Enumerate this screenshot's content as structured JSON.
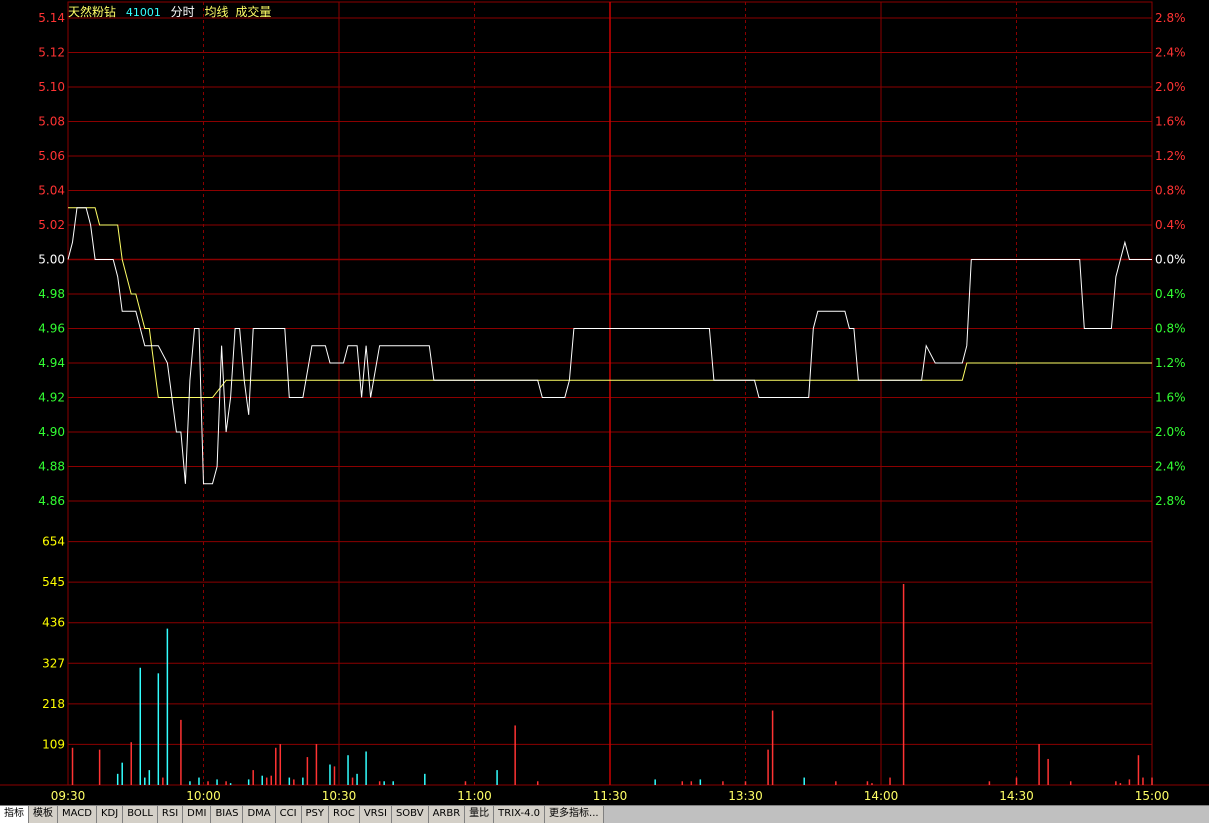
{
  "header": {
    "stock_name": "天然粉钻",
    "stock_code": "41001",
    "mode": "分时",
    "avg_label": "均线",
    "vol_label": "成交量"
  },
  "colors": {
    "background": "#000000",
    "grid": "#8b0000",
    "price_line": "#ffffff",
    "avg_line": "#ffff66",
    "up": "#ff3333",
    "down": "#33ffff",
    "price_up_label": "#ff3333",
    "price_down_label": "#33ff33",
    "volume_label": "#ffff00",
    "time_label": "#ffff66"
  },
  "tabs": [
    "指标",
    "模板",
    "MACD",
    "KDJ",
    "BOLL",
    "RSI",
    "DMI",
    "BIAS",
    "DMA",
    "CCI",
    "PSY",
    "ROC",
    "VRSI",
    "SOBV",
    "ARBR",
    "量比",
    "TRIX-4.0",
    "更多指标..."
  ],
  "chart_data": {
    "type": "line",
    "price_axis": {
      "ticks": [
        "5.14",
        "5.12",
        "5.10",
        "5.08",
        "5.06",
        "5.04",
        "5.02",
        "5.00",
        "4.98",
        "4.96",
        "4.94",
        "4.92",
        "4.90",
        "4.88",
        "4.86"
      ],
      "pct_ticks": [
        "2.8%",
        "2.4%",
        "2.0%",
        "1.6%",
        "1.2%",
        "0.8%",
        "0.4%",
        "0.0%",
        "0.4%",
        "0.8%",
        "1.2%",
        "1.6%",
        "2.0%",
        "2.4%",
        "2.8%"
      ],
      "ylim": [
        4.86,
        5.14
      ],
      "prev_close": 5.0
    },
    "volume_axis": {
      "ticks": [
        "654",
        "545",
        "436",
        "327",
        "218",
        "109"
      ],
      "ylim": [
        0,
        763
      ]
    },
    "time_axis": {
      "labels": [
        "09:30",
        "10:00",
        "10:30",
        "11:00",
        "11:30",
        "13:30",
        "14:00",
        "14:30",
        "15:00"
      ],
      "minutes": 240
    },
    "price_series": [
      [
        0,
        5.0
      ],
      [
        1,
        5.01
      ],
      [
        2,
        5.03
      ],
      [
        4,
        5.03
      ],
      [
        5,
        5.02
      ],
      [
        6,
        5.0
      ],
      [
        8,
        5.0
      ],
      [
        9,
        5.0
      ],
      [
        10,
        5.0
      ],
      [
        11,
        4.99
      ],
      [
        12,
        4.97
      ],
      [
        15,
        4.97
      ],
      [
        17,
        4.95
      ],
      [
        20,
        4.95
      ],
      [
        22,
        4.94
      ],
      [
        24,
        4.9
      ],
      [
        25,
        4.9
      ],
      [
        26,
        4.87
      ],
      [
        27,
        4.93
      ],
      [
        28,
        4.96
      ],
      [
        29,
        4.96
      ],
      [
        30,
        4.87
      ],
      [
        31,
        4.87
      ],
      [
        32,
        4.87
      ],
      [
        33,
        4.88
      ],
      [
        34,
        4.95
      ],
      [
        35,
        4.9
      ],
      [
        36,
        4.92
      ],
      [
        37,
        4.96
      ],
      [
        38,
        4.96
      ],
      [
        39,
        4.93
      ],
      [
        40,
        4.91
      ],
      [
        41,
        4.96
      ],
      [
        42,
        4.96
      ],
      [
        44,
        4.96
      ],
      [
        45,
        4.96
      ],
      [
        47,
        4.96
      ],
      [
        48,
        4.96
      ],
      [
        49,
        4.92
      ],
      [
        51,
        4.92
      ],
      [
        52,
        4.92
      ],
      [
        54,
        4.95
      ],
      [
        57,
        4.95
      ],
      [
        58,
        4.94
      ],
      [
        61,
        4.94
      ],
      [
        62,
        4.95
      ],
      [
        64,
        4.95
      ],
      [
        65,
        4.92
      ],
      [
        66,
        4.95
      ],
      [
        67,
        4.92
      ],
      [
        69,
        4.95
      ],
      [
        71,
        4.95
      ],
      [
        78,
        4.95
      ],
      [
        79,
        4.95
      ],
      [
        80,
        4.95
      ],
      [
        81,
        4.93
      ],
      [
        101,
        4.93
      ],
      [
        104,
        4.93
      ],
      [
        105,
        4.92
      ],
      [
        110,
        4.92
      ],
      [
        111,
        4.93
      ],
      [
        112,
        4.96
      ],
      [
        116,
        4.96
      ],
      [
        117,
        4.96
      ],
      [
        120,
        4.96
      ],
      [
        133,
        4.96
      ],
      [
        134,
        4.96
      ],
      [
        141,
        4.96
      ],
      [
        142,
        4.96
      ],
      [
        143,
        4.93
      ],
      [
        151,
        4.93
      ],
      [
        152,
        4.93
      ],
      [
        153,
        4.92
      ],
      [
        163,
        4.92
      ],
      [
        164,
        4.92
      ],
      [
        165,
        4.96
      ],
      [
        166,
        4.97
      ],
      [
        172,
        4.97
      ],
      [
        173,
        4.96
      ],
      [
        174,
        4.96
      ],
      [
        175,
        4.93
      ],
      [
        187,
        4.93
      ],
      [
        189,
        4.93
      ],
      [
        190,
        4.95
      ],
      [
        192,
        4.94
      ],
      [
        197,
        4.94
      ],
      [
        198,
        4.94
      ],
      [
        199,
        4.95
      ],
      [
        200,
        5.0
      ],
      [
        204,
        5.0
      ],
      [
        215,
        5.0
      ],
      [
        223,
        5.0
      ],
      [
        224,
        5.0
      ],
      [
        225,
        4.96
      ],
      [
        228,
        4.96
      ],
      [
        230,
        4.96
      ],
      [
        231,
        4.96
      ],
      [
        232,
        4.99
      ],
      [
        233,
        5.0
      ],
      [
        234,
        5.01
      ],
      [
        235,
        5.0
      ],
      [
        236,
        5.0
      ],
      [
        237,
        5.0
      ],
      [
        240,
        5.0
      ]
    ],
    "avg_series": [
      [
        0,
        5.03
      ],
      [
        3,
        5.03
      ],
      [
        6,
        5.03
      ],
      [
        7,
        5.02
      ],
      [
        10,
        5.02
      ],
      [
        11,
        5.02
      ],
      [
        12,
        5.0
      ],
      [
        13,
        4.99
      ],
      [
        14,
        4.98
      ],
      [
        15,
        4.98
      ],
      [
        17,
        4.96
      ],
      [
        18,
        4.96
      ],
      [
        19,
        4.94
      ],
      [
        20,
        4.92
      ],
      [
        22,
        4.92
      ],
      [
        23,
        4.92
      ],
      [
        25,
        4.92
      ],
      [
        32,
        4.92
      ],
      [
        35,
        4.93
      ],
      [
        37,
        4.93
      ],
      [
        38,
        4.93
      ],
      [
        40,
        4.93
      ],
      [
        45,
        4.93
      ],
      [
        49,
        4.93
      ],
      [
        53,
        4.93
      ],
      [
        54,
        4.93
      ],
      [
        57,
        4.93
      ],
      [
        62,
        4.93
      ],
      [
        63,
        4.93
      ],
      [
        65,
        4.93
      ],
      [
        68,
        4.93
      ],
      [
        71,
        4.93
      ],
      [
        72,
        4.93
      ],
      [
        74,
        4.93
      ],
      [
        77,
        4.93
      ],
      [
        82,
        4.93
      ],
      [
        85,
        4.93
      ],
      [
        90,
        4.93
      ],
      [
        95,
        4.93
      ],
      [
        97,
        4.93
      ],
      [
        100,
        4.93
      ],
      [
        104,
        4.93
      ],
      [
        108,
        4.93
      ],
      [
        112,
        4.93
      ],
      [
        114,
        4.93
      ],
      [
        122,
        4.93
      ],
      [
        130,
        4.93
      ],
      [
        140,
        4.93
      ],
      [
        150,
        4.93
      ],
      [
        160,
        4.93
      ],
      [
        170,
        4.93
      ],
      [
        180,
        4.93
      ],
      [
        190,
        4.93
      ],
      [
        198,
        4.93
      ],
      [
        199,
        4.94
      ],
      [
        210,
        4.94
      ],
      [
        220,
        4.94
      ],
      [
        226,
        4.94
      ],
      [
        227,
        4.94
      ],
      [
        228,
        4.94
      ],
      [
        235,
        4.94
      ],
      [
        240,
        4.94
      ]
    ],
    "volume_series": [
      [
        1,
        100,
        "up"
      ],
      [
        7,
        95,
        "up"
      ],
      [
        11,
        30,
        "down"
      ],
      [
        12,
        60,
        "down"
      ],
      [
        14,
        115,
        "up"
      ],
      [
        16,
        315,
        "down"
      ],
      [
        17,
        20,
        "down"
      ],
      [
        18,
        40,
        "down"
      ],
      [
        20,
        300,
        "down"
      ],
      [
        21,
        20,
        "up"
      ],
      [
        22,
        420,
        "down"
      ],
      [
        25,
        175,
        "up"
      ],
      [
        27,
        10,
        "down"
      ],
      [
        29,
        20,
        "down"
      ],
      [
        31,
        10,
        "up"
      ],
      [
        33,
        15,
        "down"
      ],
      [
        35,
        10,
        "up"
      ],
      [
        36,
        5,
        "down"
      ],
      [
        40,
        15,
        "down"
      ],
      [
        41,
        40,
        "up"
      ],
      [
        43,
        25,
        "down"
      ],
      [
        44,
        20,
        "up"
      ],
      [
        45,
        25,
        "up"
      ],
      [
        46,
        100,
        "up"
      ],
      [
        47,
        110,
        "up"
      ],
      [
        49,
        20,
        "down"
      ],
      [
        50,
        15,
        "up"
      ],
      [
        52,
        20,
        "down"
      ],
      [
        53,
        75,
        "up"
      ],
      [
        55,
        110,
        "up"
      ],
      [
        58,
        55,
        "down"
      ],
      [
        59,
        50,
        "up"
      ],
      [
        62,
        80,
        "down"
      ],
      [
        63,
        20,
        "up"
      ],
      [
        64,
        30,
        "down"
      ],
      [
        66,
        90,
        "down"
      ],
      [
        69,
        10,
        "up"
      ],
      [
        70,
        10,
        "down"
      ],
      [
        72,
        10,
        "down"
      ],
      [
        79,
        30,
        "down"
      ],
      [
        88,
        10,
        "up"
      ],
      [
        95,
        40,
        "down"
      ],
      [
        99,
        160,
        "up"
      ],
      [
        104,
        10,
        "up"
      ],
      [
        130,
        15,
        "down"
      ],
      [
        136,
        10,
        "up"
      ],
      [
        138,
        10,
        "up"
      ],
      [
        140,
        15,
        "down"
      ],
      [
        145,
        10,
        "up"
      ],
      [
        150,
        10,
        "up"
      ],
      [
        155,
        95,
        "up"
      ],
      [
        156,
        200,
        "up"
      ],
      [
        163,
        20,
        "down"
      ],
      [
        170,
        10,
        "up"
      ],
      [
        177,
        10,
        "up"
      ],
      [
        178,
        5,
        "up"
      ],
      [
        182,
        20,
        "up"
      ],
      [
        185,
        540,
        "up"
      ],
      [
        204,
        10,
        "up"
      ],
      [
        210,
        20,
        "up"
      ],
      [
        215,
        110,
        "up"
      ],
      [
        217,
        70,
        "up"
      ],
      [
        222,
        10,
        "up"
      ],
      [
        232,
        10,
        "up"
      ],
      [
        233,
        5,
        "up"
      ],
      [
        235,
        15,
        "up"
      ],
      [
        237,
        80,
        "up"
      ],
      [
        238,
        20,
        "up"
      ],
      [
        240,
        20,
        "up"
      ]
    ]
  }
}
